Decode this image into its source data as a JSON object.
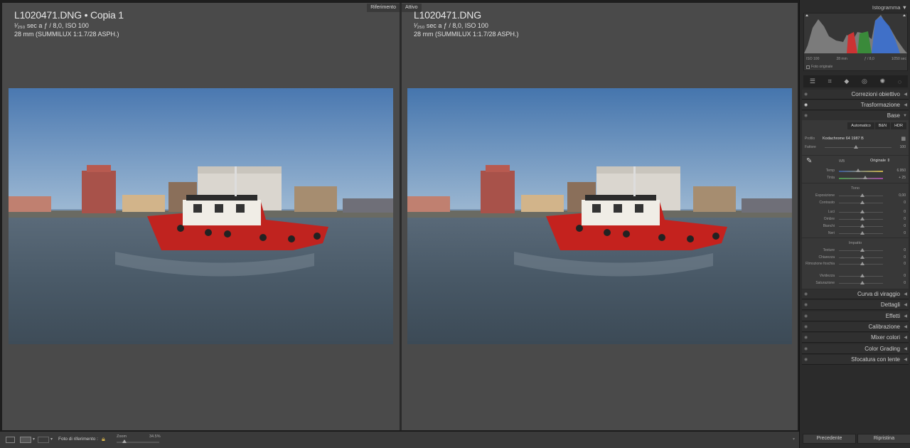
{
  "left_pane": {
    "tag": "Riferimento",
    "filename": "L1020471.DNG  •  Copia 1",
    "exposure": "¹⁄₂₅₀ sec a ƒ / 8,0, ISO 100",
    "lens": "28 mm (SUMMILUX 1:1.7/28 ASPH.)"
  },
  "right_pane": {
    "tag": "Attivo",
    "filename": "L1020471.DNG",
    "exposure": "¹⁄₂₅₀ sec a ƒ / 8,0, ISO 100",
    "lens": "28 mm (SUMMILUX 1:1.7/28 ASPH.)"
  },
  "right_panel": {
    "histogram_title": "Istogramma",
    "histogram_labels": [
      "ISO 100",
      "28 mm",
      "ƒ / 8,0",
      "1⁄250 sec"
    ],
    "original_photo": "Foto originale",
    "sections_top": [
      "Correzioni obiettivo",
      "Trasformazione",
      "Base"
    ],
    "base": {
      "buttons": [
        "Automatico",
        "B&N",
        "HDR"
      ],
      "profile_label": "Profilo",
      "profile_value": "Kodachrome 64 1987 B",
      "amount_label": "Fattore",
      "amount_value": "100",
      "wb_label": "WB",
      "wb_value": "Originale",
      "temp_label": "Temp",
      "temp_value": "6.950",
      "tint_label": "Tinta",
      "tint_value": "+ 25",
      "tone_title": "Tono",
      "tone": [
        {
          "label": "Esposizione",
          "value": "0,00"
        },
        {
          "label": "Contrasto",
          "value": "0"
        },
        {
          "label": "Luci",
          "value": "0"
        },
        {
          "label": "Ombre",
          "value": "0"
        },
        {
          "label": "Bianchi",
          "value": "0"
        },
        {
          "label": "Neri",
          "value": "0"
        }
      ],
      "presence_title": "Impatto",
      "presence": [
        {
          "label": "Texture",
          "value": "0"
        },
        {
          "label": "Chiarezza",
          "value": "0"
        },
        {
          "label": "Rimozione foschia",
          "value": "0"
        },
        {
          "label": "Vividezza",
          "value": "0"
        },
        {
          "label": "Saturazione",
          "value": "0"
        }
      ]
    },
    "sections_bottom": [
      "Curva di viraggio",
      "Dettagli",
      "Effetti",
      "Calibrazione",
      "Mixer colori",
      "Color Grading",
      "Sfocatura con lente"
    ],
    "prev_button": "Precedente",
    "reset_button": "Ripristina"
  },
  "bottom_bar": {
    "reference_label": "Foto di riferimento :",
    "zoom_label": "Zoom",
    "zoom_value": "34.5%"
  }
}
